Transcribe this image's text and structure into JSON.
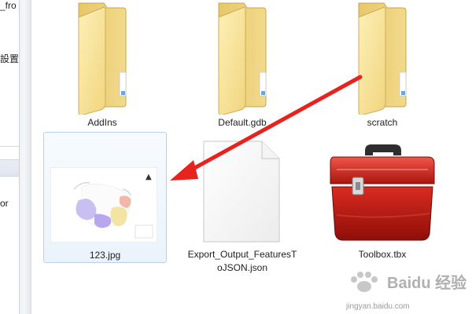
{
  "nav": {
    "items": [
      {
        "label": "_fro"
      },
      {
        "label": "設置"
      },
      {
        "label": "or"
      }
    ]
  },
  "files": [
    {
      "name": "AddIns",
      "type": "folder"
    },
    {
      "name": "Default.gdb",
      "type": "folder"
    },
    {
      "name": "scratch",
      "type": "folder"
    },
    {
      "name": "123.jpg",
      "type": "image",
      "selected": true
    },
    {
      "name": "Export_Output_FeaturesT",
      "name_line2": "oJSON.json",
      "type": "json"
    },
    {
      "name": "Toolbox.tbx",
      "type": "toolbox"
    }
  ],
  "annotation": {
    "color": "#e8231d",
    "icon": "red-arrow-icon"
  },
  "watermark": {
    "title": "Baidu 经验",
    "url": "jingyan.baidu.com"
  }
}
